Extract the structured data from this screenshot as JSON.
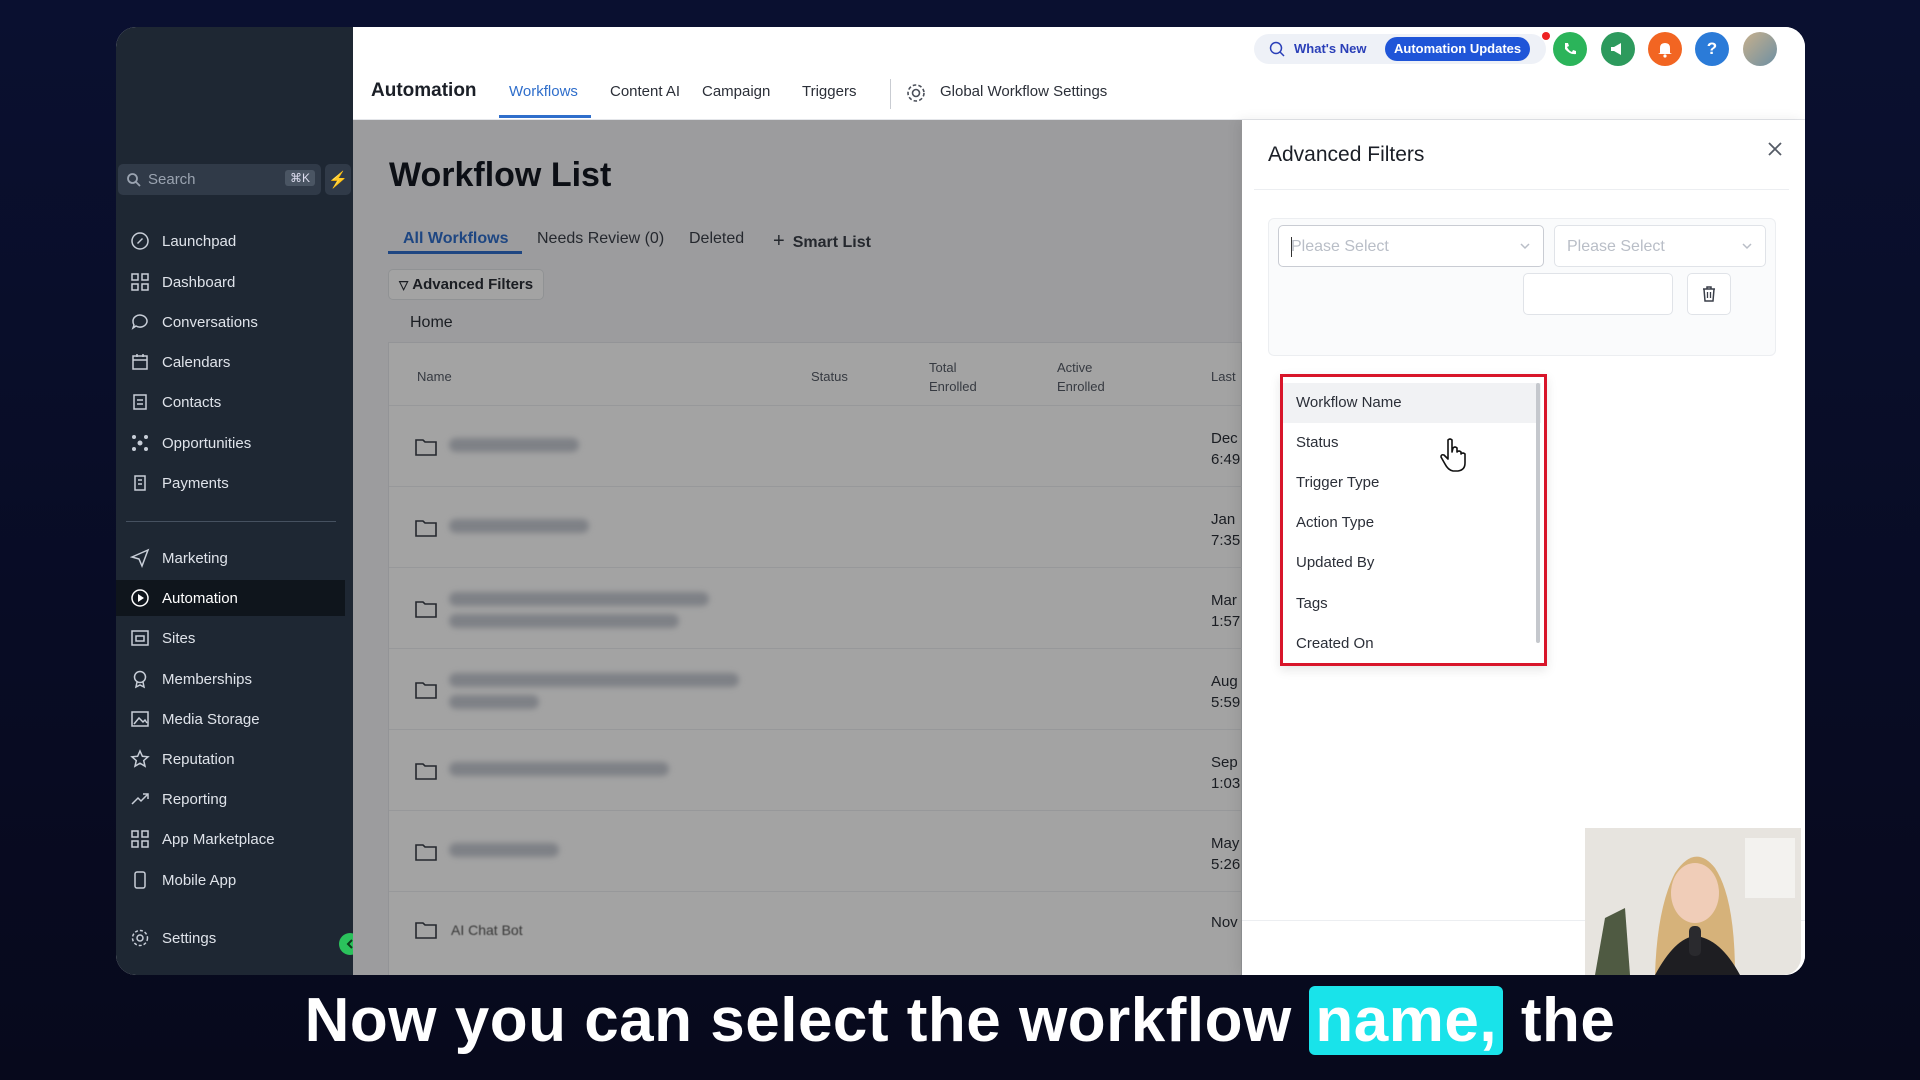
{
  "sidebar": {
    "search_placeholder": "Search",
    "search_shortcut": "⌘K",
    "items": [
      {
        "label": "Launchpad"
      },
      {
        "label": "Dashboard"
      },
      {
        "label": "Conversations"
      },
      {
        "label": "Calendars"
      },
      {
        "label": "Contacts"
      },
      {
        "label": "Opportunities"
      },
      {
        "label": "Payments"
      },
      {
        "label": "Marketing"
      },
      {
        "label": "Automation"
      },
      {
        "label": "Sites"
      },
      {
        "label": "Memberships"
      },
      {
        "label": "Media Storage"
      },
      {
        "label": "Reputation"
      },
      {
        "label": "Reporting"
      },
      {
        "label": "App Marketplace"
      },
      {
        "label": "Mobile App"
      },
      {
        "label": "Settings"
      }
    ],
    "active_item": "Automation"
  },
  "topbar": {
    "title": "Automation",
    "tabs": [
      "Workflows",
      "Content AI",
      "Campaign",
      "Triggers",
      "Global Workflow Settings"
    ],
    "active_tab": "Workflows",
    "whats_new": "What's New",
    "automation_updates": "Automation Updates",
    "help_label": "?"
  },
  "content": {
    "page_title": "Workflow List",
    "tabs": [
      "All Workflows",
      "Needs Review (0)",
      "Deleted"
    ],
    "smart_list": "Smart List",
    "advanced_filters_button": "Advanced Filters",
    "breadcrumb": "Home",
    "columns": [
      "Name",
      "Status",
      "Total\nEnrolled",
      "Active\nEnrolled",
      "Last"
    ],
    "rows": [
      {
        "date": "Dec\n6:49"
      },
      {
        "date": "Jan\n7:35"
      },
      {
        "date": "Mar\n1:57"
      },
      {
        "date": "Aug\n5:59"
      },
      {
        "date": "Sep\n1:03"
      },
      {
        "date": "May\n5:26"
      },
      {
        "name": "AI Chat Bot",
        "date": "Nov"
      }
    ]
  },
  "panel": {
    "title": "Advanced Filters",
    "field_placeholder": "Please Select",
    "operator_placeholder": "Please Select",
    "options": [
      "Workflow Name",
      "Status",
      "Trigger Type",
      "Action Type",
      "Updated By",
      "Tags",
      "Created On"
    ],
    "hovered_option": "Workflow Name"
  },
  "caption": {
    "before": "Now you can select the workflow ",
    "highlight": "name,",
    "after": " the"
  },
  "colors": {
    "accent": "#2f6ecb",
    "sidebar_bg": "#1e2733",
    "highlight_border": "#d8152a",
    "caption_highlight": "#19e3ea"
  }
}
